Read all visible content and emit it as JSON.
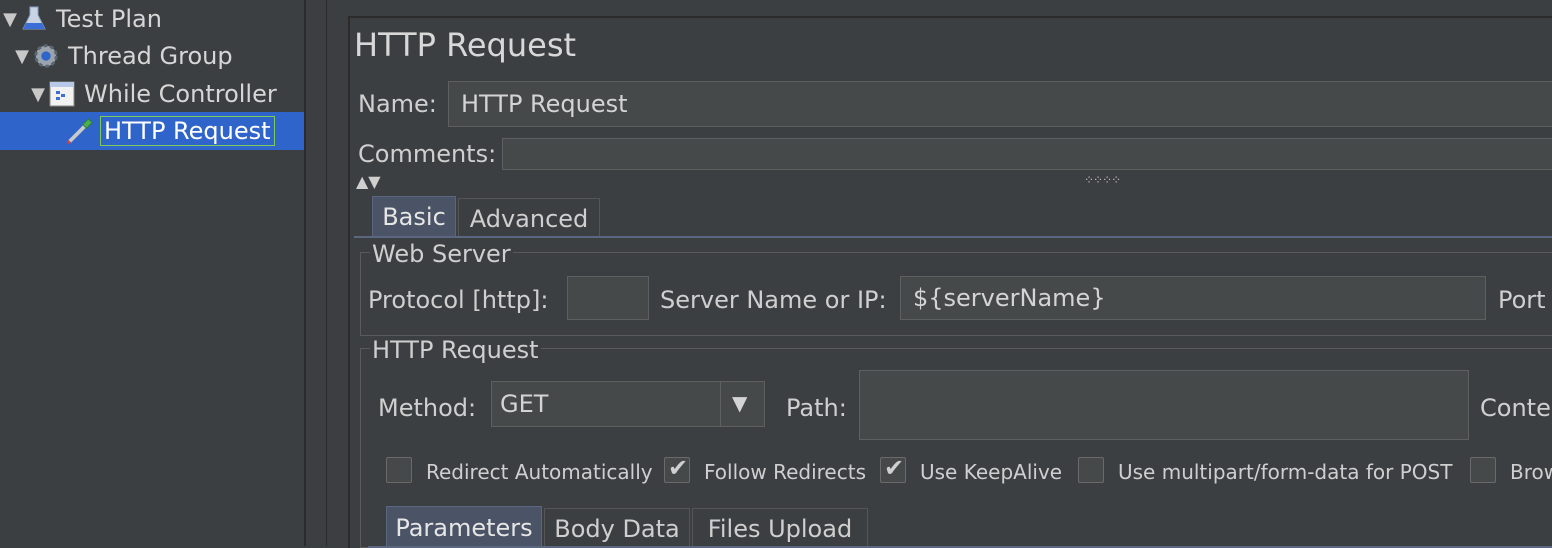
{
  "tree": {
    "items": [
      {
        "label": "Test Plan",
        "expanded": true,
        "icon": "flask-icon"
      },
      {
        "label": "Thread Group",
        "expanded": true,
        "icon": "gear-icon"
      },
      {
        "label": "While Controller",
        "expanded": true,
        "icon": "controller-icon"
      },
      {
        "label": "HTTP Request",
        "selected": true,
        "icon": "pipette-icon"
      }
    ]
  },
  "panel": {
    "title": "HTTP Request",
    "name_label": "Name:",
    "name_value": "HTTP Request",
    "comments_label": "Comments:",
    "comments_value": ""
  },
  "tabs": [
    {
      "label": "Basic",
      "active": true
    },
    {
      "label": "Advanced",
      "active": false
    }
  ],
  "web_server": {
    "legend": "Web Server",
    "protocol_label": "Protocol [http]:",
    "protocol_value": "",
    "server_label": "Server Name or IP:",
    "server_value": "${serverName}",
    "port_label": "Port"
  },
  "http_request": {
    "legend": "HTTP Request",
    "method_label": "Method:",
    "method_value": "GET",
    "path_label": "Path:",
    "path_value": "",
    "content_label": "Conte"
  },
  "options": [
    {
      "label": "Redirect Automatically",
      "checked": false
    },
    {
      "label": "Follow Redirects",
      "checked": true
    },
    {
      "label": "Use KeepAlive",
      "checked": true
    },
    {
      "label": "Use multipart/form-data for POST",
      "checked": false
    },
    {
      "label": "Brow",
      "checked": false
    }
  ],
  "subtabs": [
    {
      "label": "Parameters",
      "active": true
    },
    {
      "label": "Body Data",
      "active": false
    },
    {
      "label": "Files Upload",
      "active": false
    }
  ],
  "colors": {
    "background": "#3c3f41",
    "selection": "#2f65ca",
    "active_tab": "#4b5466"
  }
}
